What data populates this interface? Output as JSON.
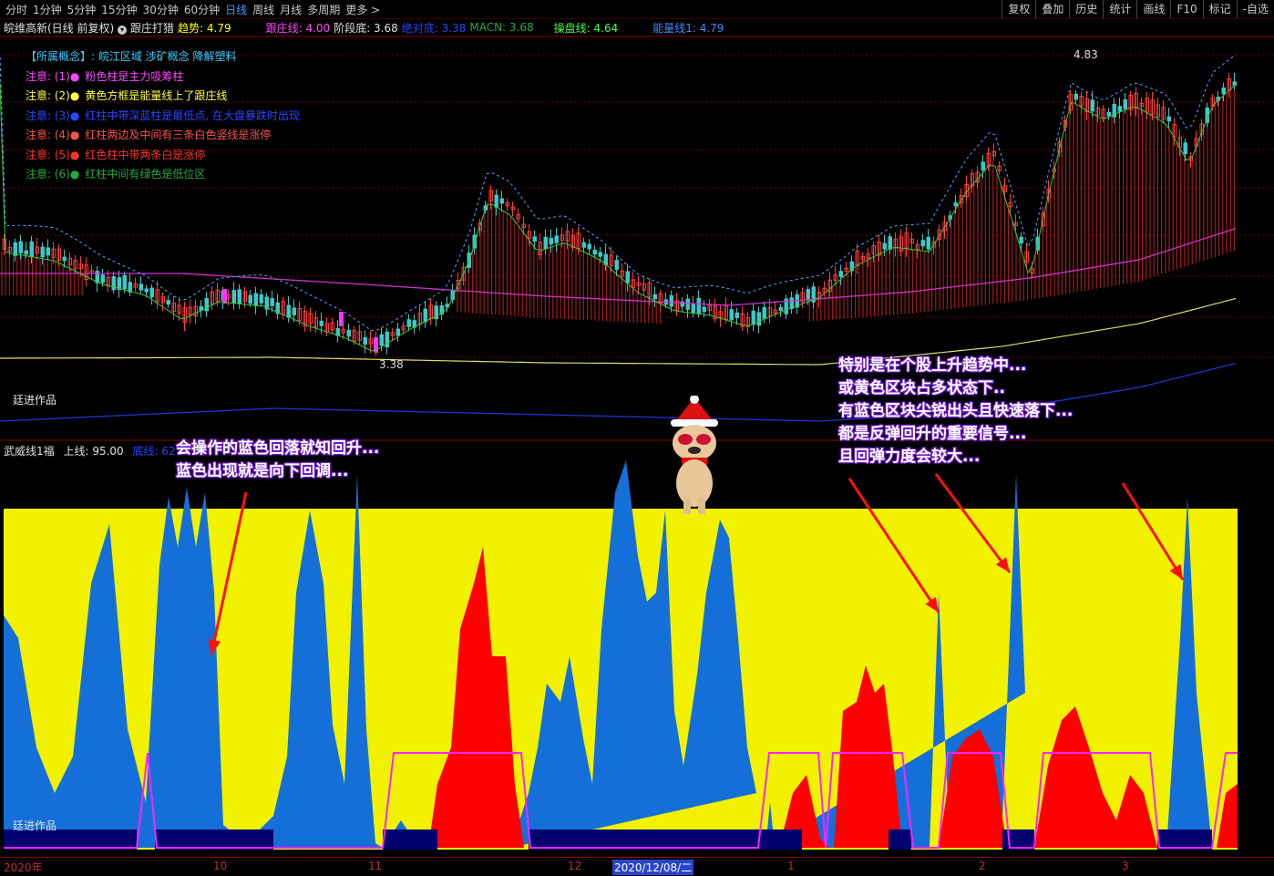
{
  "toolbar": {
    "timeframes": [
      "分时",
      "1分钟",
      "5分钟",
      "15分钟",
      "30分钟",
      "60分钟",
      "日线",
      "周线",
      "月线",
      "多周期",
      "更多 >"
    ],
    "active_timeframe": "日线",
    "right_buttons": [
      "复权",
      "叠加",
      "历史",
      "统计",
      "画线",
      "F10",
      "标记",
      "-自选"
    ]
  },
  "info": {
    "stock": "皖维高新(日线 前复权)",
    "indicator": "跟庄打猎",
    "trend": "趋势: 4.79",
    "follow": "跟庄线: 4.00",
    "stage_bottom": "阶段底: 3.68",
    "absolute_bottom": "绝对底: 3.38",
    "macn": "MACN: 3.68",
    "operate": "操盘线: 4.64",
    "energy": "能量线1: 4.79"
  },
  "notes": {
    "concept": "【所属概念】: 皖江区域 涉矿概念 降解塑料",
    "items": [
      {
        "tag": "注意: (1)●",
        "text": "粉色柱是主力吸筹柱",
        "color": "#ff44ff"
      },
      {
        "tag": "注意: (2)●",
        "text": "黄色方框是能量线上了跟庄线",
        "color": "#ffff44"
      },
      {
        "tag": "注意: (3)●",
        "text": "红柱中带深蓝柱是最低点, 在大盘暴跌时出现",
        "color": "#2a44ff"
      },
      {
        "tag": "注意: (4)●",
        "text": "红柱两边及中间有三条白色竖线是涨停",
        "color": "#ff5050"
      },
      {
        "tag": "注意: (5)●",
        "text": "红色柱中带两条白是涨停",
        "color": "#ff3030"
      },
      {
        "tag": "注意: (6)●",
        "text": "红柱中间有绿色是低位区",
        "color": "#22aa44"
      }
    ]
  },
  "main_chart": {
    "high_label": "4.83",
    "low_label": "3.38",
    "author_label": "廷进作品"
  },
  "sub_chart": {
    "name": "武威线1福",
    "upper": "上线: 95.00",
    "bottom": "底线: 62",
    "author_label": "廷进作品"
  },
  "annotations": {
    "left": [
      "会操作的蓝色回落就知回升...",
      "蓝色出现就是向下回调..."
    ],
    "right": [
      "特别是在个股上升趋势中...",
      "或黄色区块占多状态下..",
      "有蓝色区块尖锐出头且快速落下...",
      "都是反弹回升的重要信号...",
      "且回弹力度会较大..."
    ]
  },
  "axis": {
    "labels": [
      "2020年",
      "10",
      "11",
      "12",
      "2020/12/08/二",
      "1",
      "2",
      "3"
    ]
  },
  "colors": {
    "yellow_area": "#f2f200",
    "blue_area": "#1470d8",
    "red_area": "#ff0000",
    "navy_band": "#000070",
    "magenta_line": "#ff22ff",
    "candle_up": "#ff3c3c",
    "candle_down": "#3cc8c8",
    "pink_ma": "#cc33cc",
    "yellow_ma": "#d8e070",
    "blue_ma": "#2233cc"
  }
}
